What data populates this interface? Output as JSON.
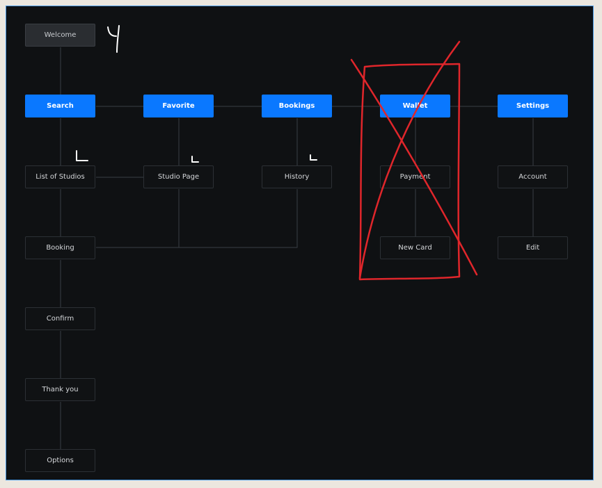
{
  "diagram": {
    "nodes": {
      "welcome": "Welcome",
      "search": "Search",
      "favorite": "Favorite",
      "bookings": "Bookings",
      "wallet": "Wallet",
      "settings": "Settings",
      "list_of_studios": "List of Studios",
      "studio_page": "Studio Page",
      "history": "History",
      "payment": "Payment",
      "account": "Account",
      "booking": "Booking",
      "new_card": "New Card",
      "edit": "Edit",
      "confirm": "Confirm",
      "thank_you": "Thank you",
      "options": "Options"
    },
    "colors": {
      "canvas": "#0f1113",
      "primary_node": "#0a78ff",
      "connector": "#3a3e44",
      "annotation_red": "#e0262b",
      "annotation_white": "#ffffff"
    }
  },
  "annotations": {
    "handwritten_mark": "Y"
  }
}
